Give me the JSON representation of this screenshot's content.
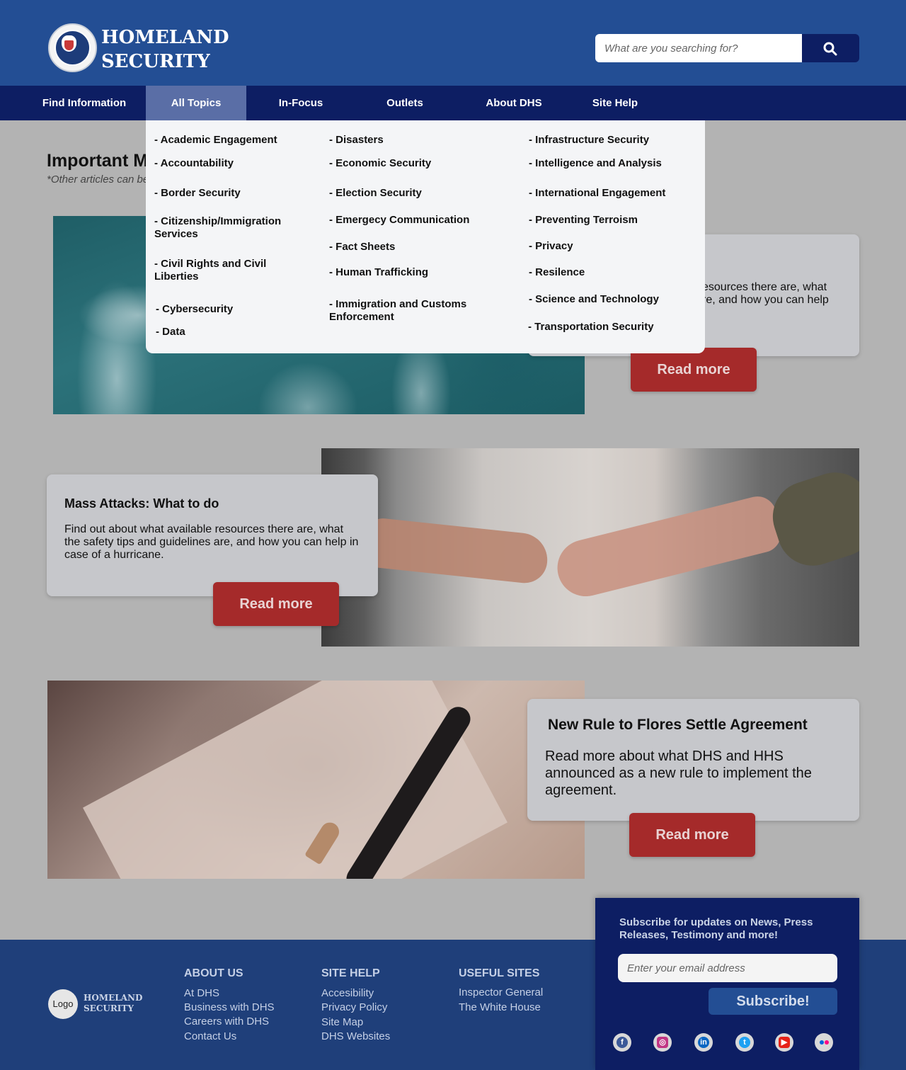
{
  "header": {
    "brand_line1": "HOMELAND",
    "brand_line2": "SECURITY",
    "search_placeholder": "What are you searching for?"
  },
  "nav": {
    "items": [
      "Find Information",
      "All Topics",
      "In-Focus",
      "Outlets",
      "About DHS",
      "Site Help"
    ],
    "active": "All Topics"
  },
  "dropdown": {
    "col1": [
      "- Academic Engagement",
      "- Accountability",
      "- Border Security",
      "- Citizenship/Immigration Services",
      "- Civil Rights and Civil Liberties",
      "- Cybersecurity",
      "- Data"
    ],
    "col2": [
      "- Disasters",
      "- Economic Security",
      "- Election Security",
      "- Emergecy Communication",
      "- Fact Sheets",
      "- Human Trafficking",
      "- Immigration and Customs Enforcement"
    ],
    "col3": [
      "- Infrastructure Security",
      "- Intelligence and Analysis",
      "- International Engagement",
      "- Preventing Terroism",
      "- Privacy",
      "- Resilence",
      "- Science and Technology",
      "- Transportation Security"
    ]
  },
  "main": {
    "section_title": "Important M",
    "section_sub": "*Other articles can be",
    "articles": [
      {
        "body_visible": "esources there are, what\nre, and how you can help",
        "button": "Read more"
      },
      {
        "title": "Mass Attacks: What to do",
        "body": "Find out about what available resources there are, what the safety tips and guidelines are, and how you can help in case of a hurricane.",
        "button": "Read more"
      },
      {
        "title": "New Rule to Flores Settle Agreement",
        "body": "Read more about what DHS and HHS announced as a new rule to implement the agreement.",
        "button": "Read more"
      }
    ]
  },
  "footer": {
    "logo": "Logo",
    "brand_line1": "HOMELAND",
    "brand_line2": "SECURITY",
    "columns": [
      {
        "heading": "ABOUT US",
        "links": [
          "At DHS",
          "Business with DHS",
          "Careers with DHS",
          "Contact Us"
        ]
      },
      {
        "heading": "SITE HELP",
        "links": [
          "Accesibility",
          "Privacy Policy",
          "Site Map",
          "DHS Websites"
        ]
      },
      {
        "heading": "USEFUL SITES",
        "links": [
          "Inspector General",
          "The White House"
        ]
      }
    ],
    "subscribe": {
      "text": "Subscribe for updates on News, Press Releases, Testimony and more!",
      "email_placeholder": "Enter your email address",
      "button": "Subscribe!"
    },
    "social": [
      "facebook-icon",
      "instagram-icon",
      "linkedin-icon",
      "twitter-icon",
      "youtube-icon",
      "flickr-icon"
    ]
  },
  "colors": {
    "header_blue": "#234e94",
    "nav_navy": "#0d1e63",
    "nav_active": "#5a6ea6",
    "button_red": "#a52a2a"
  }
}
